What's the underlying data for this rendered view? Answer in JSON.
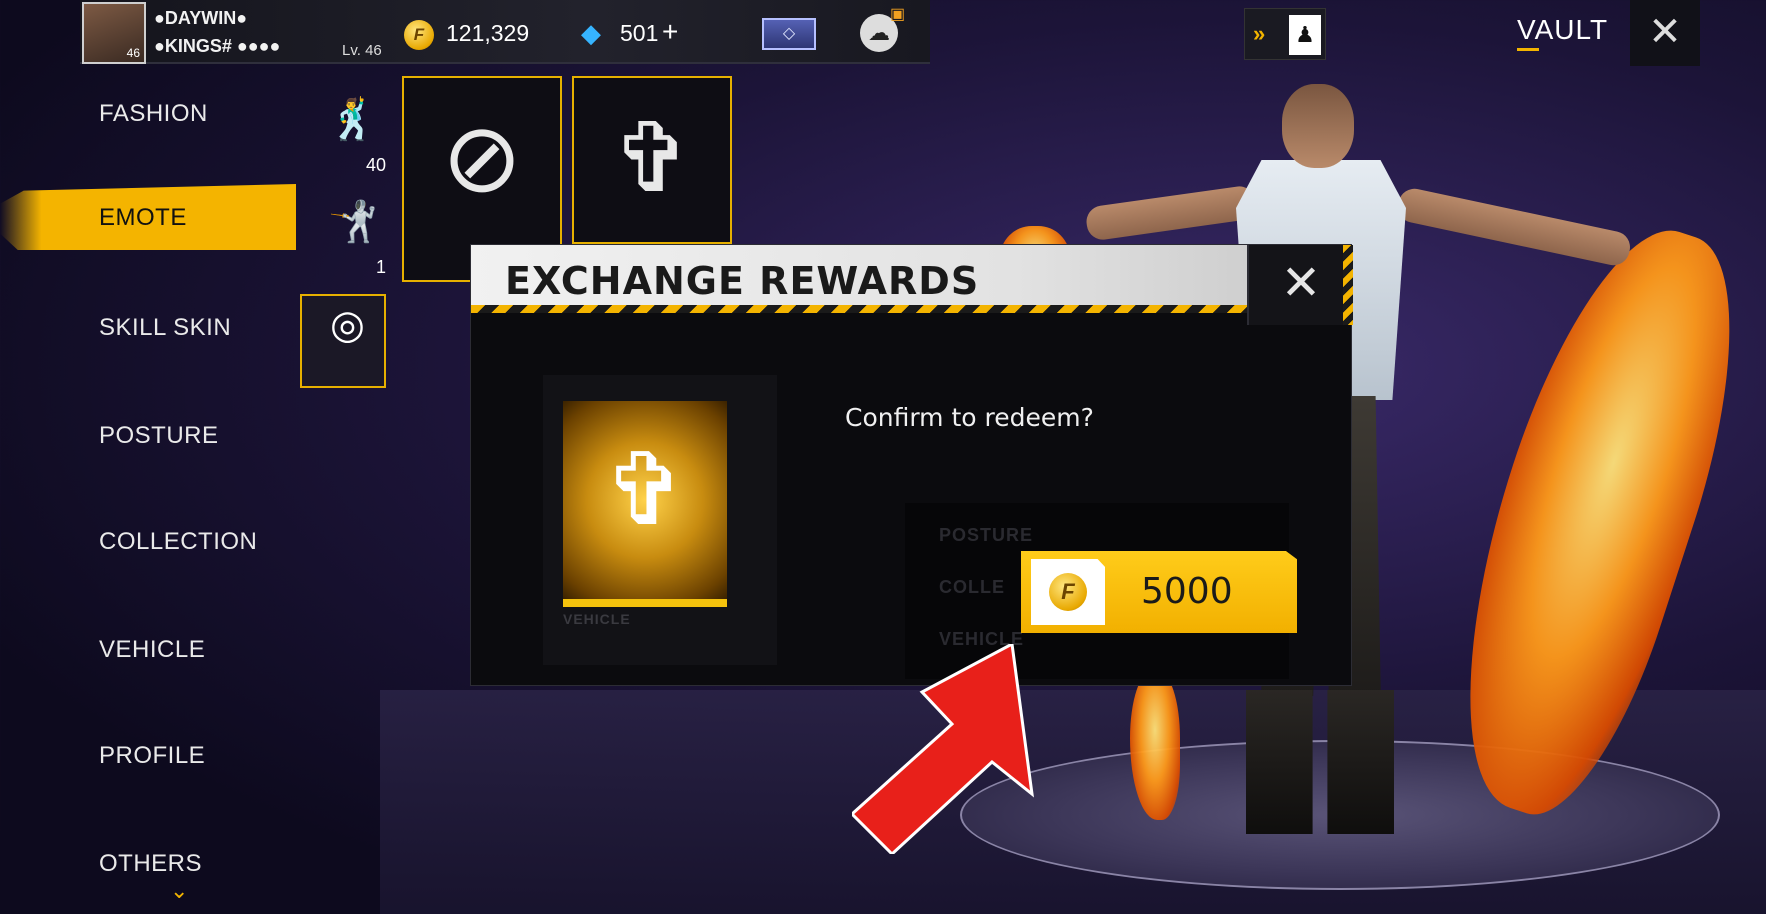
{
  "topbar": {
    "player_name_line1": "●DAYWIN●",
    "player_name_line2": "●KINGS# ●●●●",
    "avatar_level": "46",
    "level_label": "Lv. 46",
    "gold_icon": "F",
    "gold_amount": "121,329",
    "diamond_amount": "501",
    "diamond_add": "+",
    "vault_label": "VAULT"
  },
  "sidebar": {
    "items": [
      {
        "label": "FASHION"
      },
      {
        "label": "EMOTE"
      },
      {
        "label": "SKILL SKIN"
      },
      {
        "label": "POSTURE"
      },
      {
        "label": "COLLECTION"
      },
      {
        "label": "VEHICLE"
      },
      {
        "label": "PROFILE"
      },
      {
        "label": "OTHERS"
      }
    ],
    "active": "EMOTE"
  },
  "emote_column": [
    {
      "count": "40"
    },
    {
      "count": "1"
    }
  ],
  "modal": {
    "title": "EXCHANGE REWARDS",
    "confirm_text": "Confirm to redeem?",
    "price": "5000",
    "coin_icon": "F",
    "ghost_labels": [
      "POSTURE",
      "COLLE",
      "VEHICLE"
    ],
    "card_ghost_label": "VEHICLE"
  },
  "colors": {
    "accent": "#f4b400",
    "arrow": "#e8201a"
  }
}
